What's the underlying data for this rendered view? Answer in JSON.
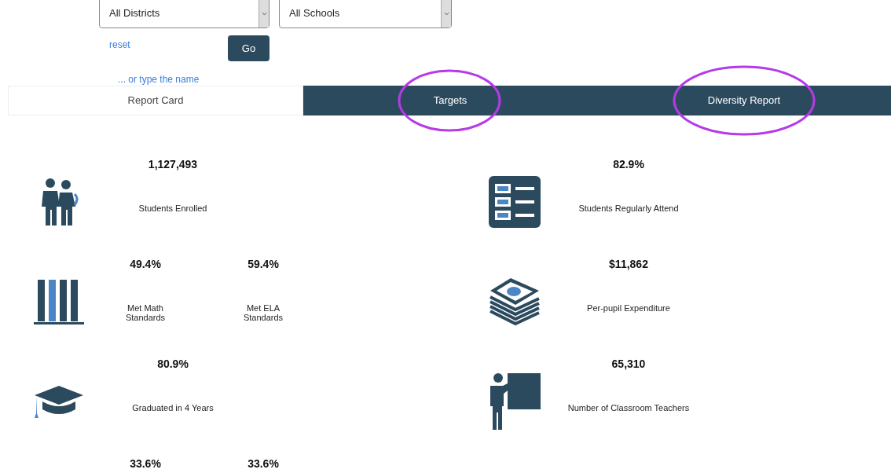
{
  "filters": {
    "district": "All Districts",
    "school": "All Schools",
    "reset": "reset",
    "go": "Go",
    "type_name": "... or type the name"
  },
  "tabs": [
    {
      "label": "Report Card",
      "selected": true,
      "highlighted": false
    },
    {
      "label": "Targets",
      "selected": false,
      "highlighted": true
    },
    {
      "label": "Diversity Report",
      "selected": false,
      "highlighted": true
    }
  ],
  "metrics_left": [
    {
      "values": [
        {
          "value": "1,127,493",
          "label": "Students Enrolled"
        }
      ]
    },
    {
      "values": [
        {
          "value": "49.4%",
          "label": "Met Math\nStandards"
        },
        {
          "value": "59.4%",
          "label": "Met ELA\nStandards"
        }
      ]
    },
    {
      "values": [
        {
          "value": "80.9%",
          "label": "Graduated in 4 Years"
        }
      ]
    },
    {
      "values": [
        {
          "value": "33.6%"
        },
        {
          "value": "33.6%"
        }
      ]
    }
  ],
  "metrics_right": [
    {
      "values": [
        {
          "value": "82.9%",
          "label": "Students Regularly Attend"
        }
      ]
    },
    {
      "values": [
        {
          "value": "$11,862",
          "label": "Per-pupil Expenditure"
        }
      ]
    },
    {
      "values": [
        {
          "value": "65,310",
          "label": "Number of Classroom Teachers"
        }
      ]
    }
  ]
}
